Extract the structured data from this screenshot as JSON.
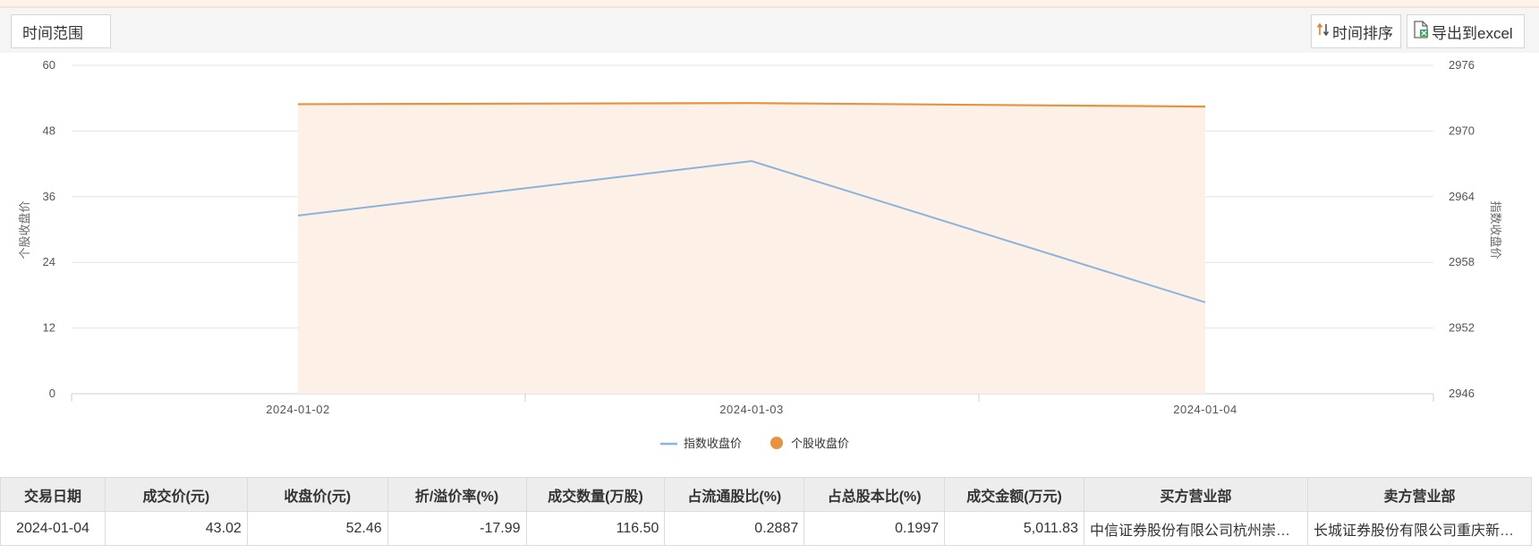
{
  "toolbar": {
    "range_label": "时间范围",
    "sort_label": "时间排序",
    "export_label": "导出到excel"
  },
  "chart_data": {
    "type": "line",
    "categories": [
      "2024-01-02",
      "2024-01-03",
      "2024-01-04"
    ],
    "series": [
      {
        "name": "指数收盘价",
        "axis": "right",
        "style": "line",
        "color": "#8ab4dc",
        "values": [
          2962.28,
          2967.25,
          2954.35
        ]
      },
      {
        "name": "个股收盘价",
        "axis": "left",
        "style": "area",
        "color": "#e8923f",
        "values": [
          52.9,
          53.1,
          52.46
        ]
      }
    ],
    "ylabel": "个股收盘价",
    "y2label": "指数收盘价",
    "ylim": [
      0,
      60
    ],
    "y2lim": [
      2946,
      2976
    ],
    "yticks": [
      "0",
      "12",
      "24",
      "36",
      "48",
      "60"
    ],
    "y2ticks": [
      "2946",
      "2952",
      "2958",
      "2964",
      "2970",
      "2976"
    ],
    "grid": true,
    "legend": "bottom-center"
  },
  "table": {
    "headers": [
      "交易日期",
      "成交价(元)",
      "收盘价(元)",
      "折/溢价率(%)",
      "成交数量(万股)",
      "占流通股比(%)",
      "占总股本比(%)",
      "成交金额(万元)",
      "买方营业部",
      "卖方营业部"
    ],
    "rows": [
      [
        "2024-01-04",
        "43.02",
        "52.46",
        "-17.99",
        "116.50",
        "0.2887",
        "0.1997",
        "5,011.83",
        "中信证券股份有限公司杭州崇…",
        "长城证券股份有限公司重庆新…"
      ]
    ]
  }
}
